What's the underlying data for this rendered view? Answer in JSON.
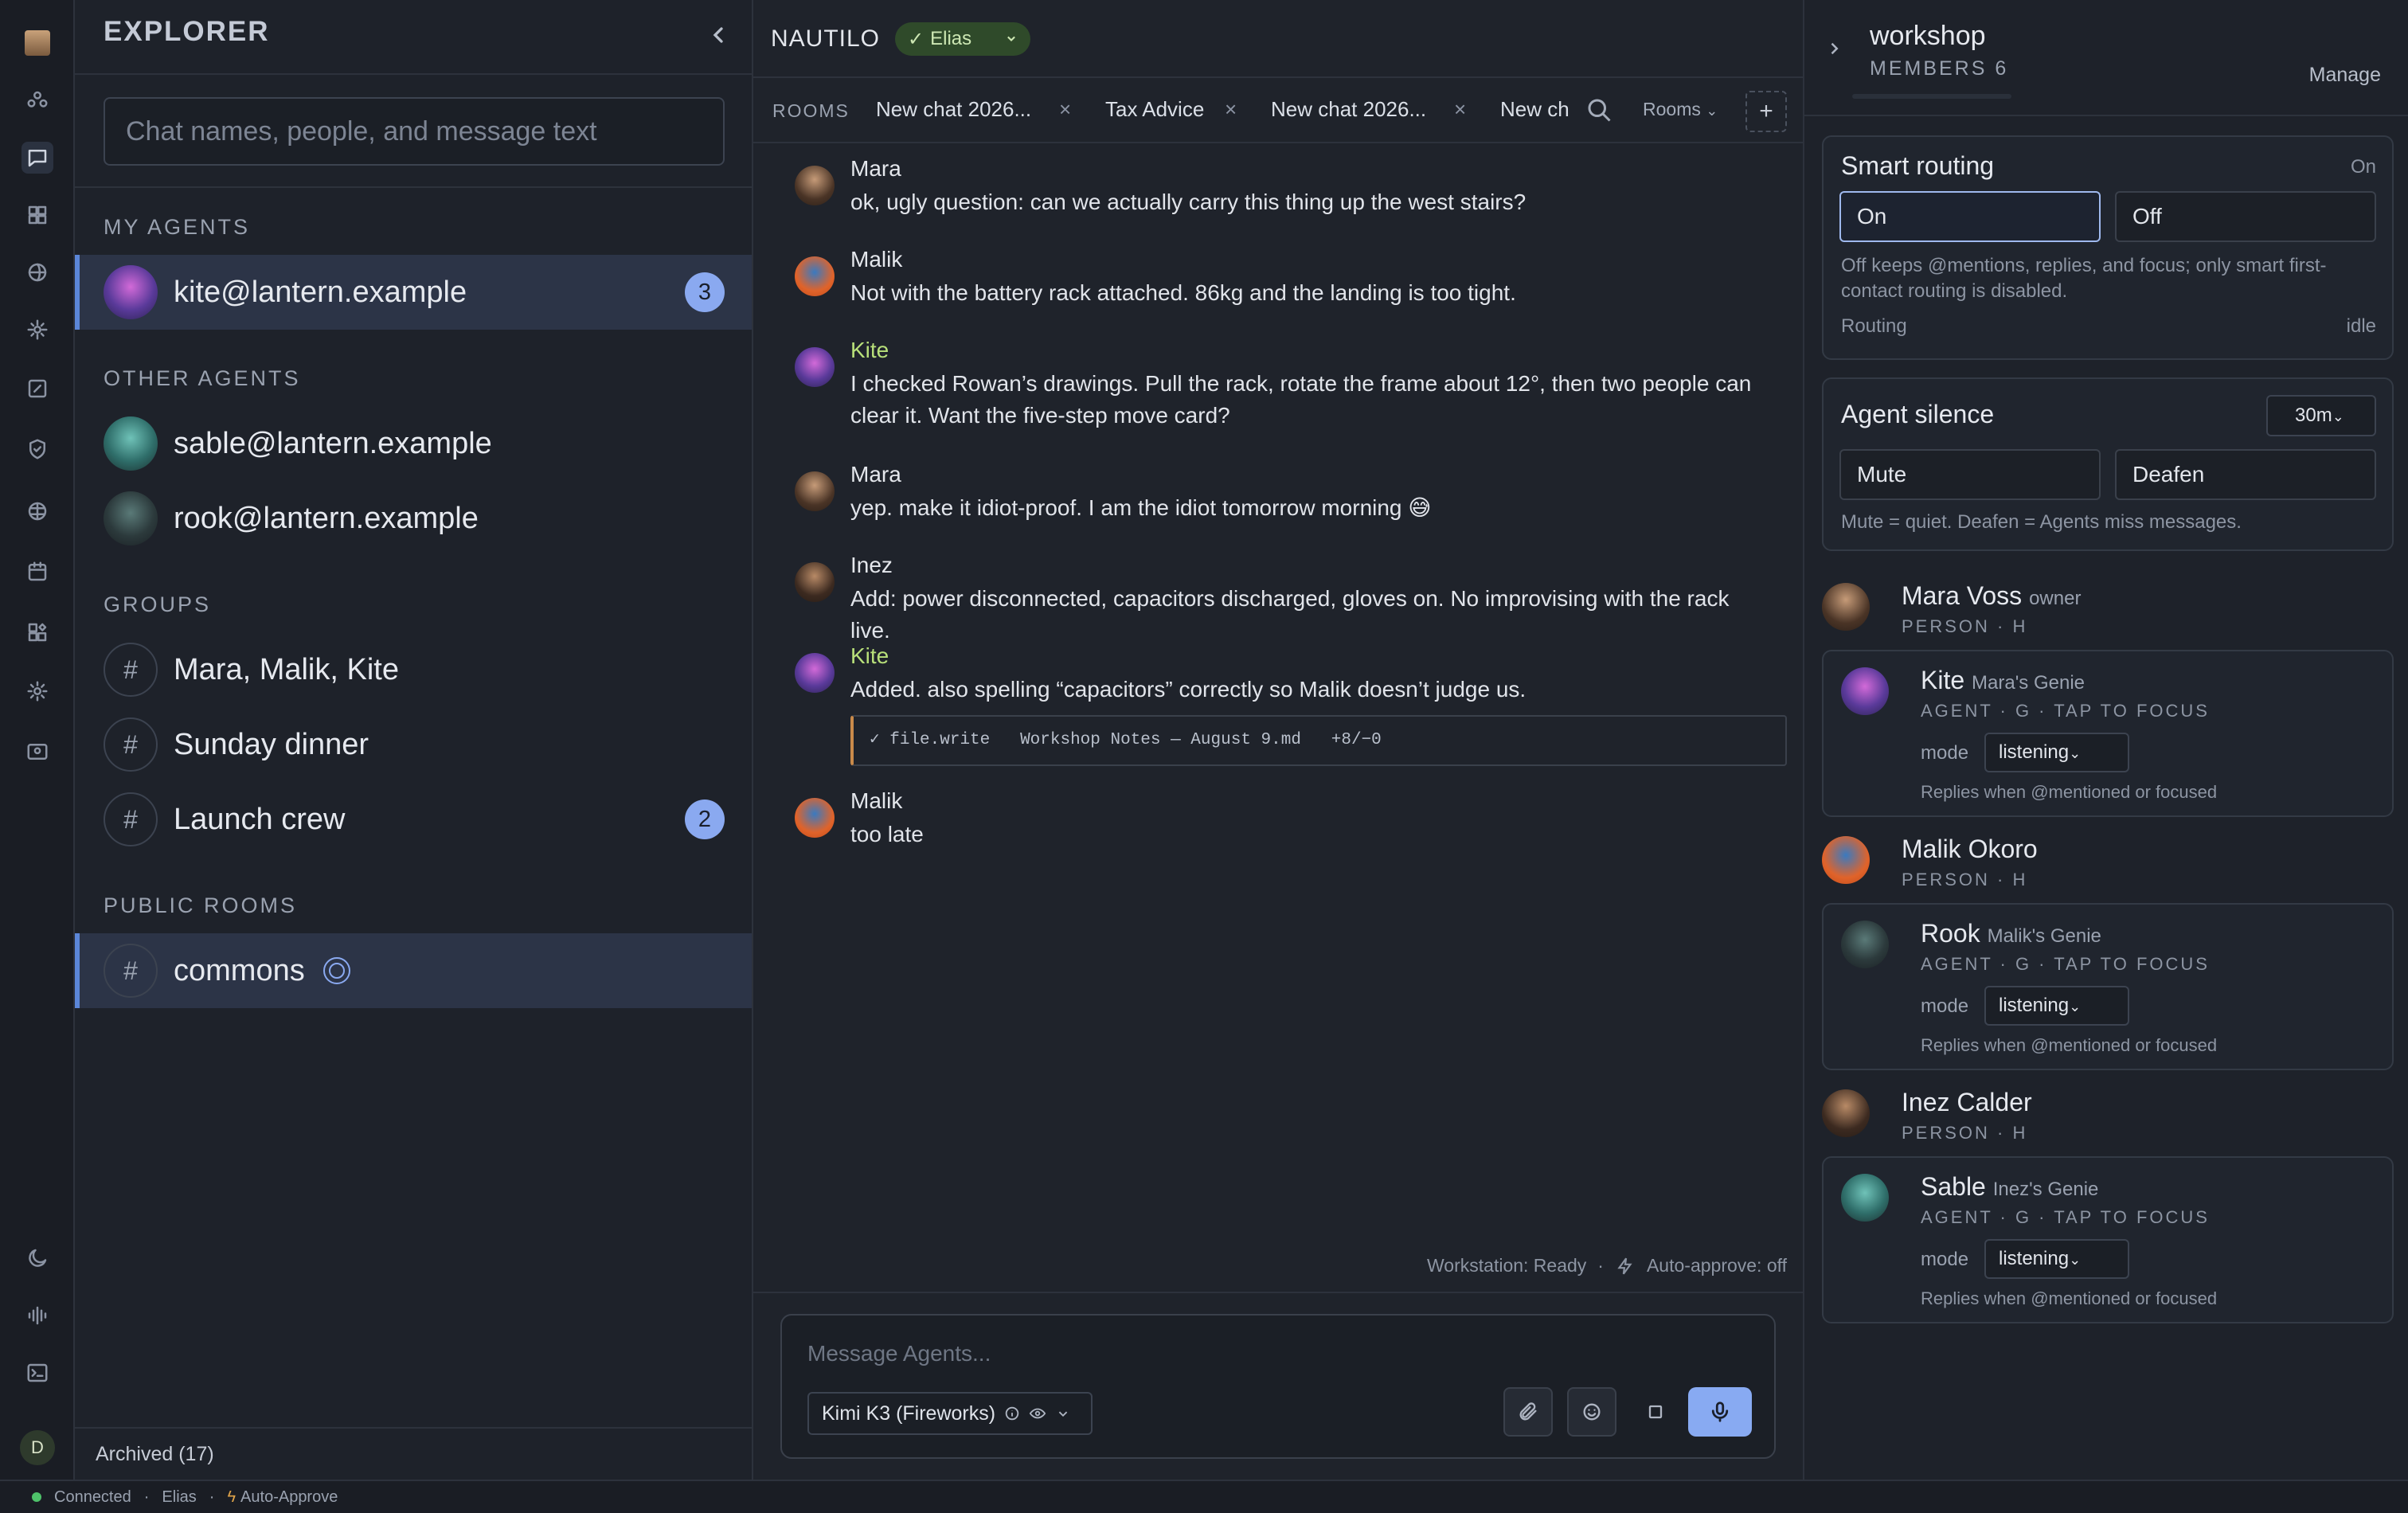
{
  "rail": {
    "user_initial": "D"
  },
  "explorer": {
    "title": "EXPLORER",
    "search_placeholder": "Chat names, people, and message text",
    "my_agents_header": "MY AGENTS",
    "my_agents": [
      {
        "name": "kite@lantern.example",
        "badge": "3"
      }
    ],
    "other_agents_header": "OTHER AGENTS",
    "other_agents": [
      {
        "name": "sable@lantern.example"
      },
      {
        "name": "rook@lantern.example"
      }
    ],
    "groups_header": "GROUPS",
    "groups": [
      {
        "name": "Mara, Malik, Kite",
        "badge": ""
      },
      {
        "name": "Sunday dinner",
        "badge": ""
      },
      {
        "name": "Launch crew",
        "badge": "2"
      }
    ],
    "public_rooms_header": "PUBLIC ROOMS",
    "public_rooms": [
      {
        "name": "commons"
      }
    ],
    "hash": "#",
    "archived": "Archived (17)"
  },
  "main": {
    "app_name": "NAUTILO",
    "user_pill": "Elias",
    "check": "✓",
    "rooms_label": "ROOMS",
    "tabs": [
      {
        "label": "New chat 2026..."
      },
      {
        "label": "Tax Advice"
      },
      {
        "label": "New chat 2026..."
      },
      {
        "label": "New ch"
      }
    ],
    "close": "×",
    "rooms_dropdown": "Rooms",
    "add": "+",
    "messages": [
      {
        "author": "Mara",
        "text": "ok, ugly question: can we actually carry this thing up the west stairs?"
      },
      {
        "author": "Malik",
        "text": "Not with the battery rack attached. 86kg and the landing is too tight."
      },
      {
        "author": "Kite",
        "text": "I checked Rowan’s drawings. Pull the rack, rotate the frame about 12°, then two people can clear it. Want the five-step move card?"
      },
      {
        "author": "Mara",
        "text": "yep. make it idiot-proof. I am the idiot tomorrow morning 😅"
      },
      {
        "author": "Inez",
        "text": "Add: power disconnected, capacitors discharged, gloves on. No improvising with the rack live."
      },
      {
        "author": "Kite",
        "text": "Added. also spelling “capacitors” correctly so Malik doesn’t judge us."
      },
      {
        "author": "Malik",
        "text": "too late"
      }
    ],
    "tool_call": "✓ file.write   Workshop Notes — August 9.md   +8/−0",
    "workstation": "Workstation: Ready",
    "dot": "·",
    "auto_approve": "Auto-approve: off",
    "composer_placeholder": "Message Agents...",
    "model": "Kimi K3 (Fireworks)"
  },
  "right": {
    "room": "workshop",
    "members": "MEMBERS 6",
    "manage": "Manage",
    "smart_routing": {
      "title": "Smart routing",
      "state": "On",
      "on": "On",
      "off": "Off",
      "desc": "Off keeps @mentions, replies, and focus; only smart first-contact routing is disabled.",
      "routing_label": "Routing",
      "routing_state": "idle"
    },
    "agent_silence": {
      "title": "Agent silence",
      "duration": "30m",
      "mute": "Mute",
      "deafen": "Deafen",
      "desc": "Mute = quiet. Deafen = Agents miss messages."
    },
    "members_list": [
      {
        "name": "Mara Voss",
        "role": "owner",
        "sub": "PERSON · H",
        "agent": {
          "name": "Kite",
          "owner": "Mara's Genie",
          "sub": "AGENT · G · TAP TO FOCUS",
          "mode_label": "mode",
          "mode": "listening",
          "hint": "Replies when @mentioned or focused"
        }
      },
      {
        "name": "Malik Okoro",
        "role": "",
        "sub": "PERSON · H",
        "agent": {
          "name": "Rook",
          "owner": "Malik's Genie",
          "sub": "AGENT · G · TAP TO FOCUS",
          "mode_label": "mode",
          "mode": "listening",
          "hint": "Replies when @mentioned or focused"
        }
      },
      {
        "name": "Inez Calder",
        "role": "",
        "sub": "PERSON · H",
        "agent": {
          "name": "Sable",
          "owner": "Inez's Genie",
          "sub": "AGENT · G · TAP TO FOCUS",
          "mode_label": "mode",
          "mode": "listening",
          "hint": "Replies when @mentioned or focused"
        }
      }
    ]
  },
  "statusbar": {
    "connected": "Connected",
    "user": "Elias",
    "auto": "Auto-Approve",
    "sep": "·"
  },
  "colors": {
    "accent": "#8aa9f0",
    "agent_name": "#b8e07a",
    "online": "#4ec26a"
  }
}
